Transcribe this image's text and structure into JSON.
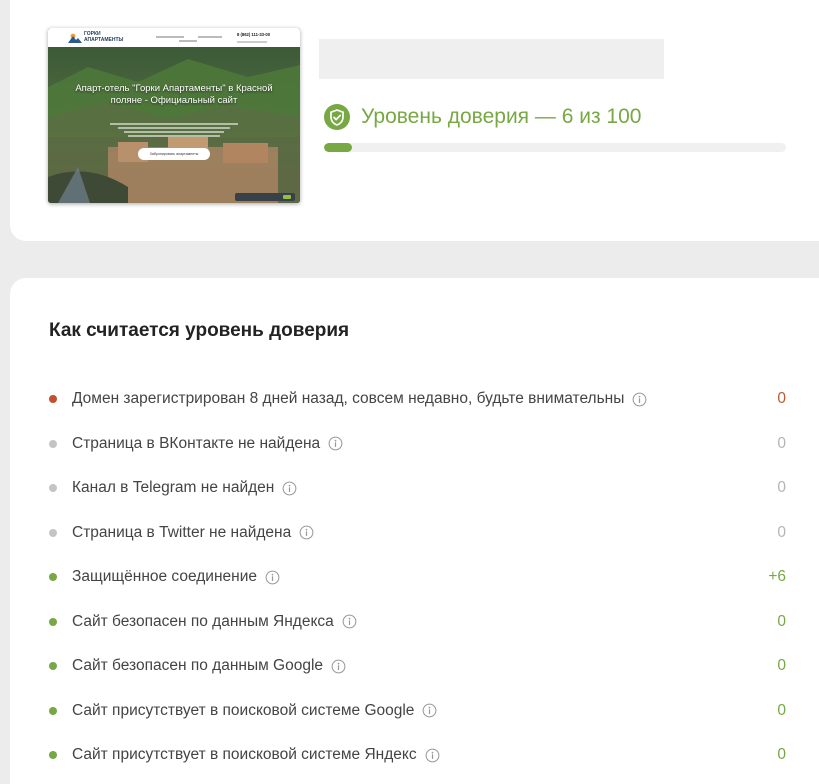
{
  "preview": {
    "brand_line1": "ГОРКИ",
    "brand_line2": "АПАРТАМЕНТЫ",
    "phone": "8 (862) 111-33-00",
    "hero_title": "Апарт-отель \"Горки Апартаменты\" в Красной поляне - Официальный сайт",
    "book_button": "Забронировать апартаменты"
  },
  "trust": {
    "title": "Уровень доверия — 6 из 100",
    "value": 6,
    "max": 100,
    "color": "#77a843"
  },
  "section_title": "Как считается уровень доверия",
  "factors": [
    {
      "label": "Домен зарегистрирован 8 дней назад, совсем недавно, будьте внимательны",
      "score": "0",
      "dot": "#c0502e",
      "score_color": "#b85a35"
    },
    {
      "label": "Страница в ВКонтакте не найдена",
      "score": "0",
      "dot": "#c4c4c4",
      "score_color": "#b5b5b5"
    },
    {
      "label": "Канал в Telegram не найден",
      "score": "0",
      "dot": "#c4c4c4",
      "score_color": "#b5b5b5"
    },
    {
      "label": "Страница в Twitter не найдена",
      "score": "0",
      "dot": "#c4c4c4",
      "score_color": "#b5b5b5"
    },
    {
      "label": "Защищённое соединение",
      "score": "+6",
      "dot": "#77a843",
      "score_color": "#77a843"
    },
    {
      "label": "Сайт безопасен по данным Яндекса",
      "score": "0",
      "dot": "#77a843",
      "score_color": "#77a843"
    },
    {
      "label": "Сайт безопасен по данным Google",
      "score": "0",
      "dot": "#77a843",
      "score_color": "#77a843"
    },
    {
      "label": "Сайт присутствует в поисковой системе Google",
      "score": "0",
      "dot": "#77a843",
      "score_color": "#77a843"
    },
    {
      "label": "Сайт присутствует в поисковой системе Яндекс",
      "score": "0",
      "dot": "#77a843",
      "score_color": "#77a843"
    }
  ]
}
